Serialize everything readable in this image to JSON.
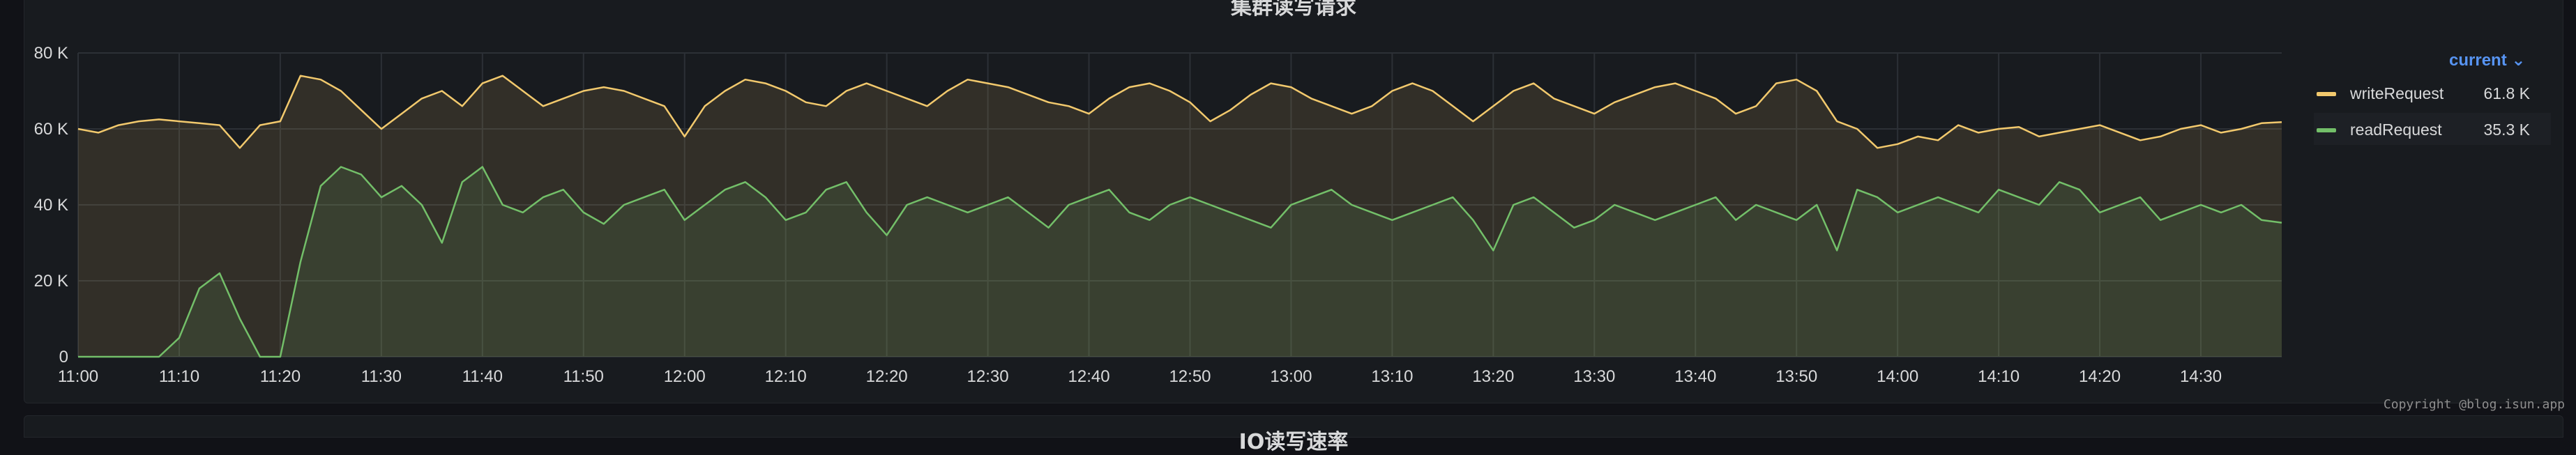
{
  "panel": {
    "title": "集群读写请求",
    "next_title": "IO读写速率"
  },
  "legend": {
    "header": "current",
    "header_icon": "chevron-down-icon",
    "items": [
      {
        "name": "writeRequest",
        "value": "61.8 K",
        "color": "#f2c96d"
      },
      {
        "name": "readRequest",
        "value": "35.3 K",
        "color": "#73bf69"
      }
    ]
  },
  "copyright": "Copyright @blog.isun.app",
  "chart_data": {
    "type": "area",
    "title": "集群读写请求",
    "ylim": [
      0,
      80000
    ],
    "yticks": [
      0,
      20000,
      40000,
      60000,
      80000
    ],
    "ytick_labels": [
      "0",
      "20 K",
      "40 K",
      "60 K",
      "80 K"
    ],
    "xlim": [
      "11:00",
      "14:38"
    ],
    "xtick_labels": [
      "11:00",
      "11:10",
      "11:20",
      "11:30",
      "11:40",
      "11:50",
      "12:00",
      "12:10",
      "12:20",
      "12:30",
      "12:40",
      "12:50",
      "13:00",
      "13:10",
      "13:20",
      "13:30",
      "13:40",
      "13:50",
      "14:00",
      "14:10",
      "14:20",
      "14:30"
    ],
    "grid": true,
    "legend_position": "right",
    "x_minutes_from": "11:00",
    "x": [
      0,
      2,
      4,
      6,
      8,
      10,
      12,
      14,
      16,
      18,
      20,
      22,
      24,
      26,
      28,
      30,
      32,
      34,
      36,
      38,
      40,
      42,
      44,
      46,
      48,
      50,
      52,
      54,
      56,
      58,
      60,
      62,
      64,
      66,
      68,
      70,
      72,
      74,
      76,
      78,
      80,
      82,
      84,
      86,
      88,
      90,
      92,
      94,
      96,
      98,
      100,
      102,
      104,
      106,
      108,
      110,
      112,
      114,
      116,
      118,
      120,
      122,
      124,
      126,
      128,
      130,
      132,
      134,
      136,
      138,
      140,
      142,
      144,
      146,
      148,
      150,
      152,
      154,
      156,
      158,
      160,
      162,
      164,
      166,
      168,
      170,
      172,
      174,
      176,
      178,
      180,
      182,
      184,
      186,
      188,
      190,
      192,
      194,
      196,
      198,
      200,
      202,
      204,
      206,
      208,
      210,
      212,
      214,
      216,
      218
    ],
    "series": [
      {
        "name": "writeRequest",
        "color": "#f2c96d",
        "values": [
          60000,
          59000,
          61000,
          62000,
          62500,
          62000,
          61500,
          61000,
          55000,
          61000,
          62000,
          74000,
          73000,
          70000,
          65000,
          60000,
          64000,
          68000,
          70000,
          66000,
          72000,
          74000,
          70000,
          66000,
          68000,
          70000,
          71000,
          70000,
          68000,
          66000,
          58000,
          66000,
          70000,
          73000,
          72000,
          70000,
          67000,
          66000,
          70000,
          72000,
          70000,
          68000,
          66000,
          70000,
          73000,
          72000,
          71000,
          69000,
          67000,
          66000,
          64000,
          68000,
          71000,
          72000,
          70000,
          67000,
          62000,
          65000,
          69000,
          72000,
          71000,
          68000,
          66000,
          64000,
          66000,
          70000,
          72000,
          70000,
          66000,
          62000,
          66000,
          70000,
          72000,
          68000,
          66000,
          64000,
          67000,
          69000,
          71000,
          72000,
          70000,
          68000,
          64000,
          66000,
          72000,
          73000,
          70000,
          62000,
          60000,
          55000,
          56000,
          58000,
          57000,
          61000,
          59000,
          60000,
          60500,
          58000,
          59000,
          60000,
          61000,
          59000,
          57000,
          58000,
          60000,
          61000,
          59000,
          60000,
          61500,
          61800
        ]
      },
      {
        "name": "readRequest",
        "color": "#73bf69",
        "values": [
          0,
          0,
          0,
          0,
          0,
          5000,
          18000,
          22000,
          10000,
          0,
          0,
          25000,
          45000,
          50000,
          48000,
          42000,
          45000,
          40000,
          30000,
          46000,
          50000,
          40000,
          38000,
          42000,
          44000,
          38000,
          35000,
          40000,
          42000,
          44000,
          36000,
          40000,
          44000,
          46000,
          42000,
          36000,
          38000,
          44000,
          46000,
          38000,
          32000,
          40000,
          42000,
          40000,
          38000,
          40000,
          42000,
          38000,
          34000,
          40000,
          42000,
          44000,
          38000,
          36000,
          40000,
          42000,
          40000,
          38000,
          36000,
          34000,
          40000,
          42000,
          44000,
          40000,
          38000,
          36000,
          38000,
          40000,
          42000,
          36000,
          28000,
          40000,
          42000,
          38000,
          34000,
          36000,
          40000,
          38000,
          36000,
          38000,
          40000,
          42000,
          36000,
          40000,
          38000,
          36000,
          40000,
          28000,
          44000,
          42000,
          38000,
          40000,
          42000,
          40000,
          38000,
          44000,
          42000,
          40000,
          46000,
          44000,
          38000,
          40000,
          42000,
          36000,
          38000,
          40000,
          38000,
          40000,
          36000,
          35300
        ]
      }
    ]
  }
}
